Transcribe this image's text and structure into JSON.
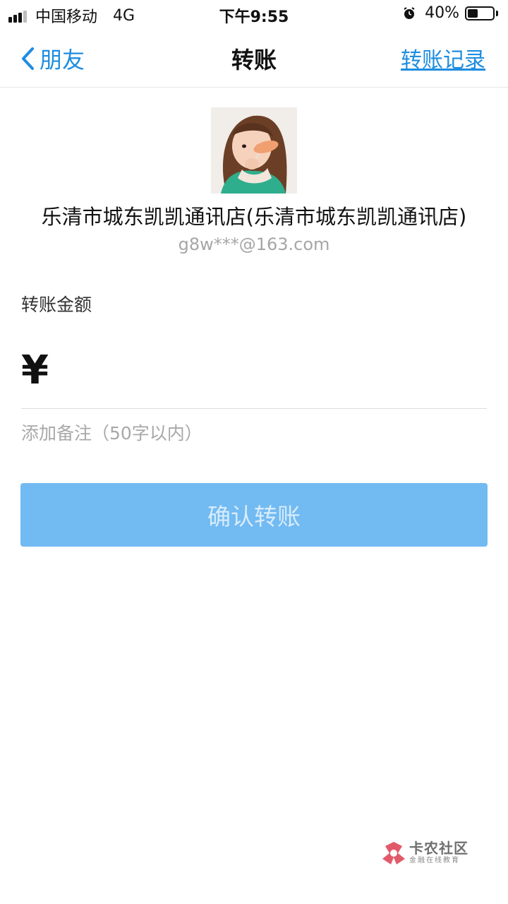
{
  "status_bar": {
    "carrier": "中国移动",
    "network": "4G",
    "time": "下午9:55",
    "battery_percent": "40%",
    "battery_level": 0.4,
    "signal_bars": 3,
    "signal_max": 4
  },
  "nav": {
    "back_label": "朋友",
    "title": "转账",
    "right_label": "转账记录",
    "accent_color": "#1e8de0"
  },
  "recipient": {
    "name": "乐清市城东凯凯通讯店(乐清市城东凯凯通讯店)",
    "account": "g8w***@163.com"
  },
  "amount": {
    "label": "转账金额",
    "currency_symbol": "¥",
    "value": ""
  },
  "note": {
    "placeholder": "添加备注（50字以内）"
  },
  "confirm": {
    "label": "确认转账",
    "color": "#72baf2"
  },
  "watermark": {
    "title": "卡农社区",
    "subtitle": "金融在线教育"
  }
}
